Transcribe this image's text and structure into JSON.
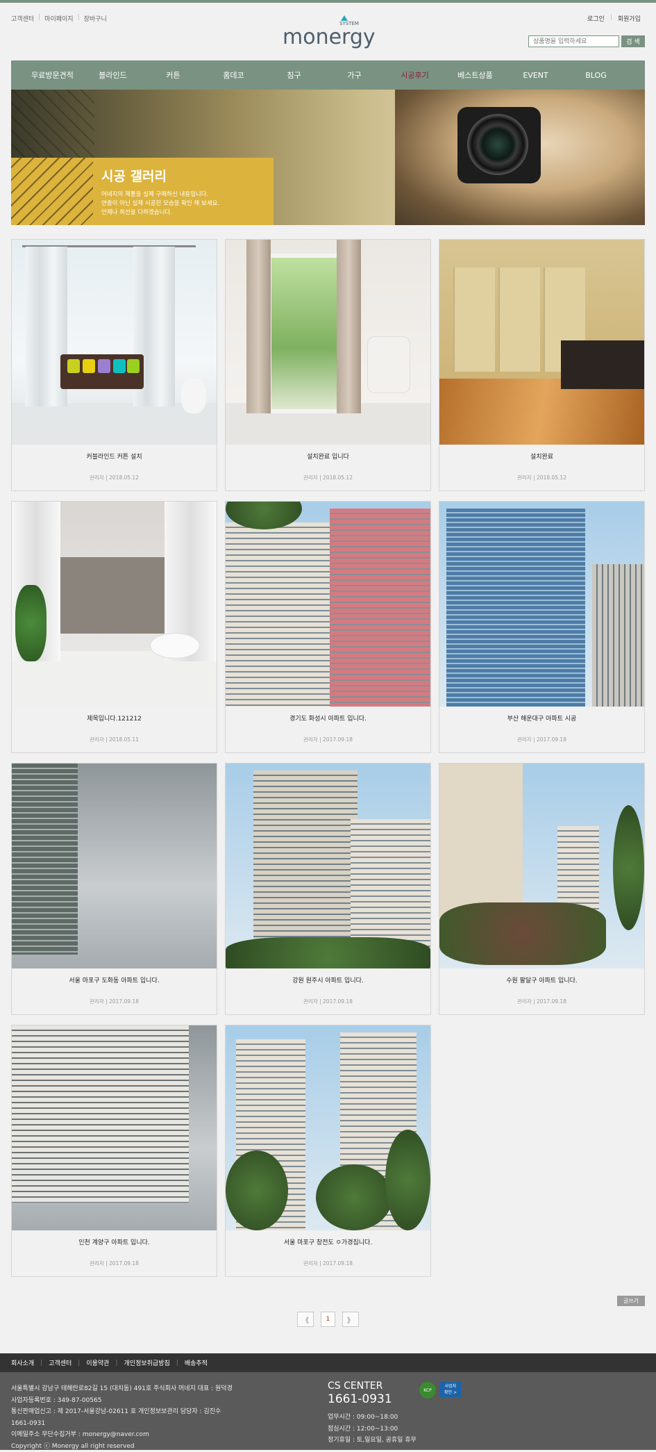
{
  "util_left": [
    "고객센터",
    "마이페이지",
    "장바구니"
  ],
  "util_right": [
    "로그인",
    "회원가입"
  ],
  "logo": {
    "text": "monergy",
    "small": "SYSTEM"
  },
  "search": {
    "placeholder": "상품명을 입력하세요",
    "button": "검 색"
  },
  "nav": [
    "무료방문견적",
    "블라인드",
    "커튼",
    "홈데코",
    "침구",
    "가구",
    "시공후기",
    "베스트상품",
    "EVENT",
    "BLOG"
  ],
  "nav_active_index": 6,
  "banner": {
    "title": "시공 갤러리",
    "desc": [
      "머네지의 제품을 실제 구매하신 내용입니다.",
      "연출이 아닌 실제 시공된 모습을 확인 해 보세요.",
      "언제나 최선을 다하겠습니다."
    ]
  },
  "gallery": [
    {
      "title": "커블라인드 커튼 설치",
      "meta": "관리자 | 2018.05.12"
    },
    {
      "title": "설치완료 입니다",
      "meta": "관리자 | 2018.05.12"
    },
    {
      "title": "설치완료",
      "meta": "관리자 | 2018.05.12"
    },
    {
      "title": "제목입니다.121212",
      "meta": "관리자 | 2018.05.11"
    },
    {
      "title": "경기도 화성시 아파트 입니다.",
      "meta": "관리자 | 2017.09.18"
    },
    {
      "title": "부산 해운대구 아파트 시공",
      "meta": "관리자 | 2017.09.18"
    },
    {
      "title": "서울 마포구 도화동 아파트 입니다.",
      "meta": "관리자 | 2017.09.18"
    },
    {
      "title": "강원 원주시 아파트 입니다.",
      "meta": "관리자 | 2017.09.18"
    },
    {
      "title": "수원 팔달구 아파트 입니다.",
      "meta": "관리자 | 2017.09.18"
    },
    {
      "title": "인천 계양구 아파트 입니다.",
      "meta": "관리자 | 2017.09.18"
    },
    {
      "title": "서울 마포구 창전도 ㅇ가경집니다.",
      "meta": "관리자 | 2017.09.18"
    }
  ],
  "write_button": "글쓰기",
  "pager": {
    "prev": "《",
    "current": "1",
    "next": "》"
  },
  "footer_links": [
    "회사소개",
    "고객센터",
    "이용약관",
    "개인정보취급방침",
    "배송추적"
  ],
  "footer_info": [
    "서울특별시 강남구 테헤란로82길 15 (대치동) 491호    주식회사 머네지    대표 : 원덕경",
    "사업자등록번호 : 349-87-00565",
    "통신판매업신고 : 제 2017-서울강남-02611 호     개인정보보관리 담당자 : 김진수",
    "1661-0931",
    "이메일주소 무단수집거부 : monergy@naver.com",
    "Copyright ⓒ Monergy all right reserved"
  ],
  "cs": {
    "title": "CS CENTER",
    "number": "1661-0931",
    "lines": [
      "업무시간 : 09:00~18:00",
      "점심시간 : 12:00~13:00",
      "정기휴일 : 토,일요일, 공휴일 휴무"
    ]
  },
  "badges": {
    "kcp": "KCP",
    "biz": "사업자\n확인 >"
  }
}
